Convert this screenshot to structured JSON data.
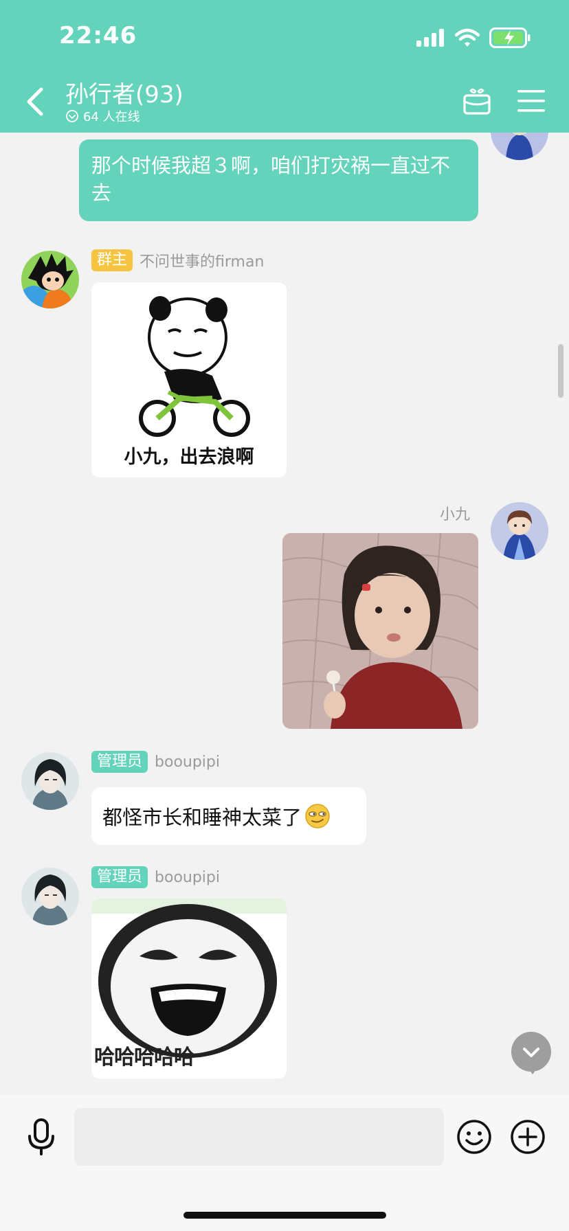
{
  "status_bar": {
    "time": "22:46"
  },
  "header": {
    "title": "孙行者(93)",
    "online": "64 人在线"
  },
  "messages": {
    "m1": {
      "text": "那个时候我超３啊，咱们打灾祸一直过不去"
    },
    "m2": {
      "badge": "群主",
      "name": "不问世事的firman",
      "caption": "小九，出去浪啊"
    },
    "m3": {
      "name": "小九"
    },
    "m4": {
      "badge": "管理员",
      "name": "booupipi",
      "text": "都怪市长和睡神太菜了"
    },
    "m5": {
      "badge": "管理员",
      "name": "booupipi",
      "caption": "哈哈哈哈哈"
    }
  },
  "input": {
    "placeholder": ""
  },
  "colors": {
    "header": "#63d3bb",
    "own_bubble": "#63d3bb",
    "owner_badge": "#f5c542",
    "admin_badge": "#63d3bb",
    "background": "#f2f2f2"
  },
  "icons": [
    "chevron-left-icon",
    "online-check-icon",
    "gift-icon",
    "menu-icon",
    "microphone-icon",
    "emoji-icon",
    "plus-icon",
    "chevron-down-icon"
  ]
}
